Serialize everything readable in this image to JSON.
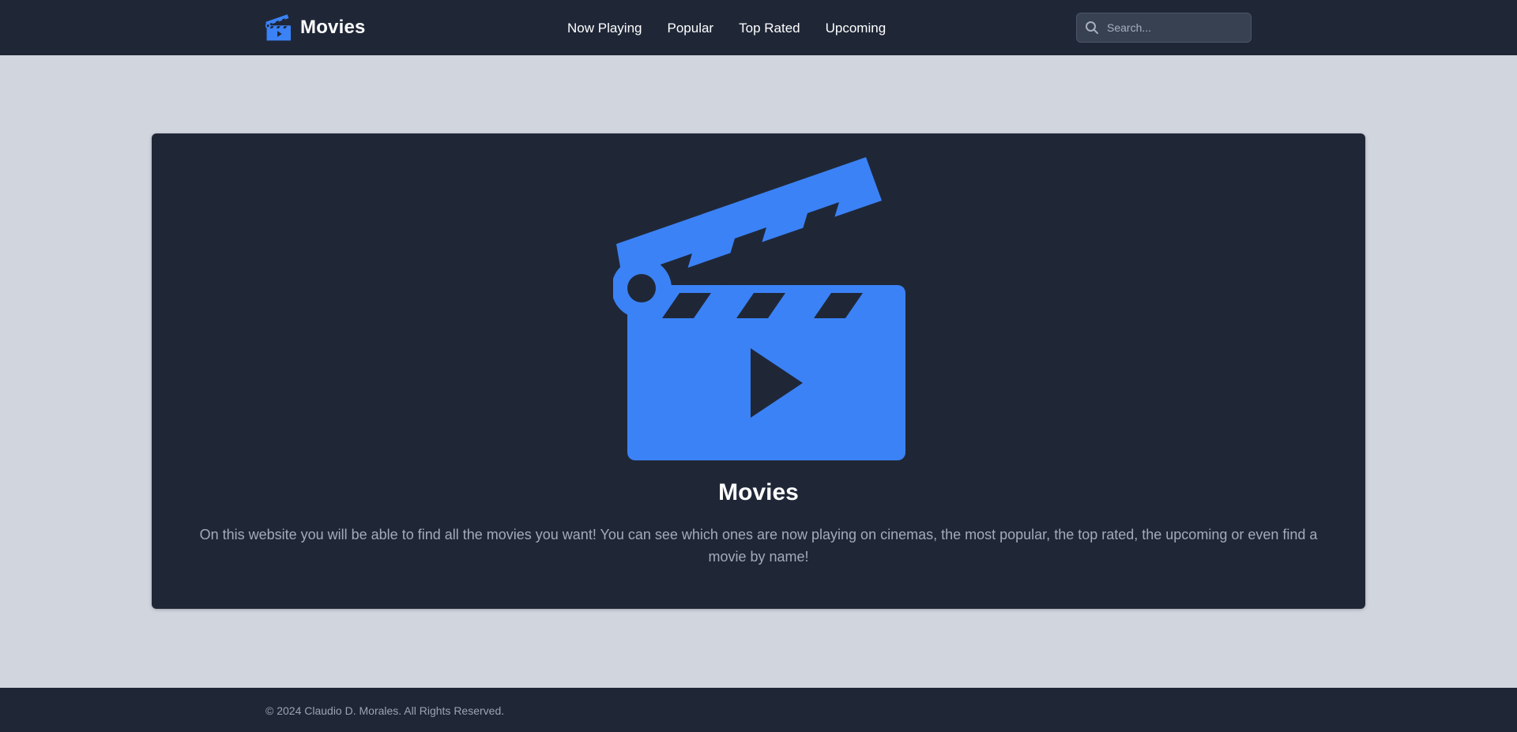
{
  "header": {
    "brand": "Movies",
    "brand_icon": "clapperboard-icon",
    "nav": [
      {
        "label": "Now Playing"
      },
      {
        "label": "Popular"
      },
      {
        "label": "Top Rated"
      },
      {
        "label": "Upcoming"
      }
    ],
    "search": {
      "placeholder": "Search...",
      "value": "",
      "icon": "search-icon"
    }
  },
  "hero": {
    "icon": "clapperboard-icon",
    "title": "Movies",
    "description": "On this website you will be able to find all the movies you want! You can see which ones are now playing on cinemas, the most popular, the top rated, the upcoming or even find a movie by name!"
  },
  "footer": {
    "copyright": "© 2024 Claudio D. Morales. All Rights Reserved."
  },
  "colors": {
    "accent": "#3b82f6",
    "surface": "#1f2737",
    "background": "#d1d5de"
  }
}
